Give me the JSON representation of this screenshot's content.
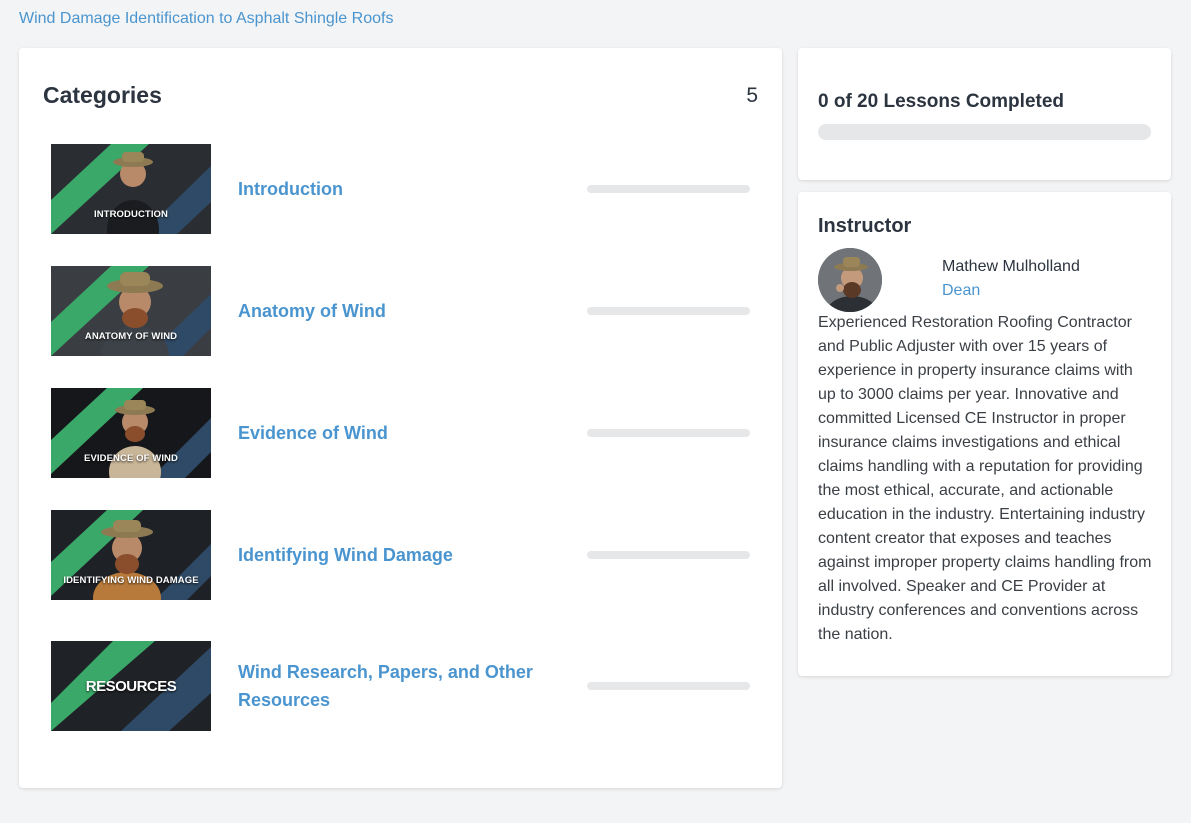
{
  "breadcrumb": {
    "course_title": "Wind Damage Identification to Asphalt Shingle Roofs"
  },
  "categories": {
    "heading": "Categories",
    "count": "5",
    "items": [
      {
        "title": "Introduction",
        "thumb_label": "INTRODUCTION",
        "progress": 0
      },
      {
        "title": "Anatomy of Wind",
        "thumb_label": "ANATOMY OF WIND",
        "progress": 0
      },
      {
        "title": "Evidence of Wind",
        "thumb_label": "EVIDENCE OF WIND",
        "progress": 0
      },
      {
        "title": "Identifying Wind Damage",
        "thumb_label": "IDENTIFYING WIND DAMAGE",
        "progress": 0
      },
      {
        "title": "Wind Research, Papers, and Other Resources",
        "thumb_label": "RESOURCES",
        "progress": 0
      }
    ]
  },
  "lessons": {
    "completed_text": "0 of 20 Lessons Completed",
    "completed": 0,
    "total": 20
  },
  "instructor": {
    "heading": "Instructor",
    "name": "Mathew Mulholland",
    "role": "Dean",
    "bio": "Experienced Restoration Roofing Contractor and Public Adjuster with over 15 years of experience in property insurance claims with up to 3000 claims per year. Innovative and committed Licensed CE Instructor in proper insurance claims investigations and ethical claims handling with a reputation for providing the most ethical, accurate, and actionable education in the industry. Entertaining industry content creator that exposes and teaches against improper property claims handling from all involved. Speaker and CE Provider at industry conferences and conventions across the nation."
  },
  "colors": {
    "accent": "#4a95cf",
    "text": "#2c3440",
    "track": "#e6e7e9",
    "thumb_green": "#3aa868",
    "thumb_blue": "#2f4a66"
  },
  "icons": {
    "avatar": "instructor-avatar"
  }
}
